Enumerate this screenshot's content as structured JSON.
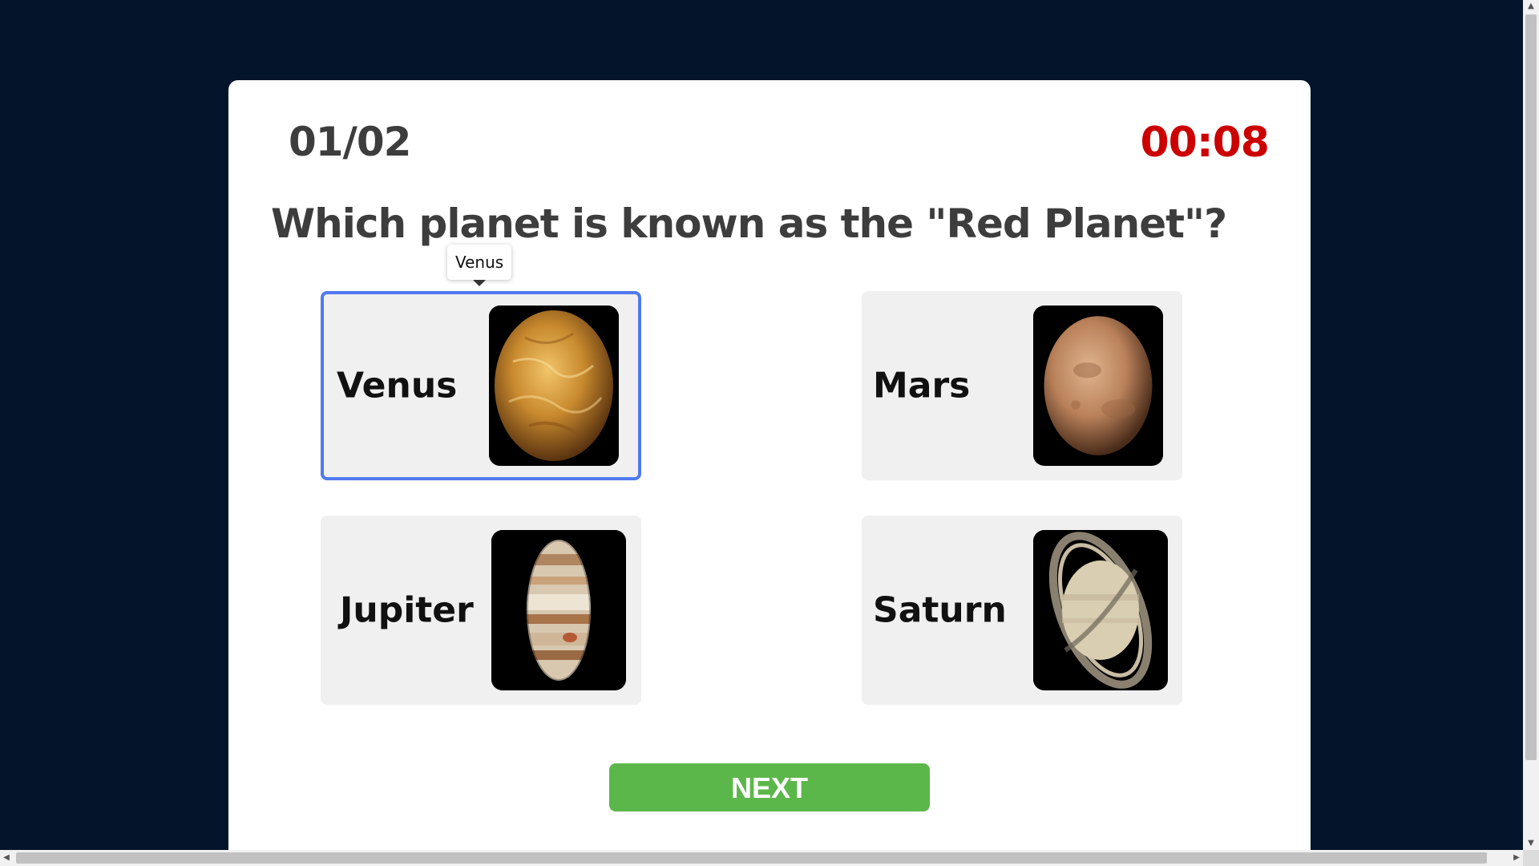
{
  "quiz": {
    "counter": "01/02",
    "timer": "00:08",
    "question": "Which planet is known as the \"Red Planet\"?",
    "tooltip": "Venus",
    "next_label": "NEXT"
  },
  "options": [
    {
      "label": "Venus",
      "icon": "venus-planet-image",
      "selected": true
    },
    {
      "label": "Mars",
      "icon": "mars-planet-image",
      "selected": false
    },
    {
      "label": "Jupiter",
      "icon": "jupiter-planet-image",
      "selected": false
    },
    {
      "label": "Saturn",
      "icon": "saturn-planet-image",
      "selected": false
    }
  ],
  "colors": {
    "background": "#04142a",
    "card": "#ffffff",
    "timer": "#cc0000",
    "selected_border": "#5179ee",
    "next_button": "#5cb74a",
    "option_bg": "#f0f0f0"
  }
}
